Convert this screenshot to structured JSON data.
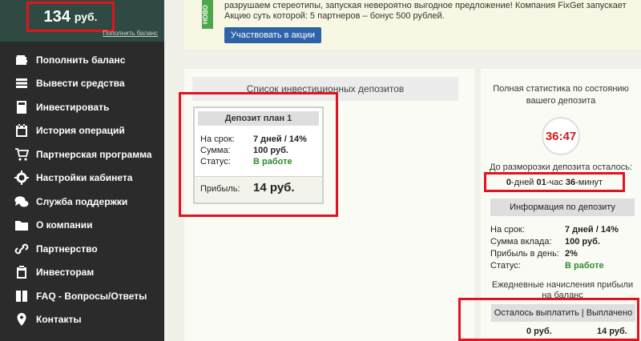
{
  "sidebar": {
    "balance": {
      "amount": "134",
      "currency": "руб.",
      "topup_link": "Пополнить баланс"
    },
    "menu": [
      {
        "label": "Пополнить баланс",
        "icon": "wallet-icon"
      },
      {
        "label": "Вывести средства",
        "icon": "cash-stack-icon"
      },
      {
        "label": "Инвестировать",
        "icon": "calculator-icon"
      },
      {
        "label": "История операций",
        "icon": "calendar-icon"
      },
      {
        "label": "Партнерская программа",
        "icon": "cart-icon"
      },
      {
        "label": "Настройки кабинета",
        "icon": "gear-icon"
      },
      {
        "label": "Служба поддержки",
        "icon": "chat-icon"
      },
      {
        "label": "О компании",
        "icon": "folder-icon"
      },
      {
        "label": "Партнерство",
        "icon": "link-icon"
      },
      {
        "label": "Инвесторам",
        "icon": "clipboard-icon"
      },
      {
        "label": "FAQ - Вопросы/Ответы",
        "icon": "book-icon"
      },
      {
        "label": "Контакты",
        "icon": "map-pin-icon"
      }
    ]
  },
  "promo": {
    "tag": "НОВО",
    "text": "разрушаем стереотипы, запуская невероятно выгодное предложение! Компания FixGet запускает Акцию суть которой: 5 партнеров – бонус 500 рублей.",
    "button": "Участвовать в акции"
  },
  "deposits": {
    "header": "Список инвестиционных депозитов",
    "card": {
      "title": "Депозит план 1",
      "rows": [
        {
          "label": "На срок:",
          "value": "7 дней / 14%"
        },
        {
          "label": "Сумма:",
          "value": "100 руб."
        },
        {
          "label": "Статус:",
          "value": "В работе"
        }
      ],
      "profit_label": "Прибыль:",
      "profit_value": "14 руб."
    }
  },
  "stats": {
    "title": "Полная статистика по состоянию вашего депозита",
    "timer": "36:47",
    "unfreeze_label": "До разморозки депозита осталось:",
    "countdown": {
      "days": "0",
      "days_unit": "-дней",
      "hours": "01",
      "hours_unit": "-час",
      "minutes": "36",
      "minutes_unit": "-минут"
    },
    "info_header": "Информация по депозиту",
    "info_rows": [
      {
        "label": "На срок:",
        "value": "7 дней / 14%"
      },
      {
        "label": "Сумма вклада:",
        "value": "100 руб."
      },
      {
        "label": "Прибыль в день:",
        "value": "2%"
      },
      {
        "label": "Статус:",
        "value": "В работе"
      }
    ],
    "daily_text": "Ежедневные начисления прибыли на баланс",
    "payout_header": "Осталось выплатить | Выплачено",
    "remaining": "0 руб.",
    "paid": "14 руб."
  },
  "colors": {
    "highlight": "#e0141e",
    "status_green": "#2e8b2e",
    "button_blue": "#2f63a8",
    "timer_red": "#d21f1f"
  }
}
